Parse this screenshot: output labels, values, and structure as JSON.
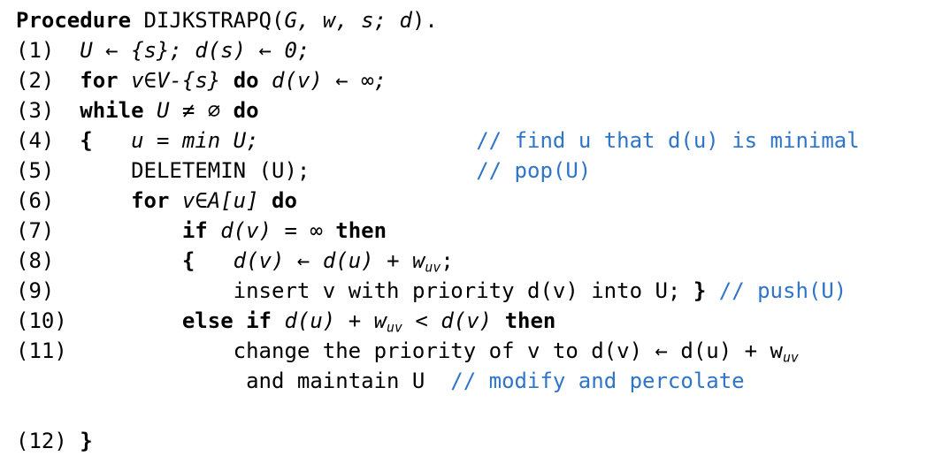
{
  "header": {
    "keyword": "Procedure",
    "name": "DIJKSTRAPQ",
    "args_open": "(",
    "args": "G, w, s; d",
    "args_close": ")."
  },
  "lines": [
    {
      "num": "(1)"
    },
    {
      "num": "(2)"
    },
    {
      "num": "(3)"
    },
    {
      "num": "(4)"
    },
    {
      "num": "(5)"
    },
    {
      "num": "(6)"
    },
    {
      "num": "(7)"
    },
    {
      "num": "(8)"
    },
    {
      "num": "(9)"
    },
    {
      "num": "(10)"
    },
    {
      "num": "(11)"
    },
    {
      "num": "(12)"
    }
  ],
  "comments": {
    "line4": "// find u that d(u) is minimal",
    "line5": "// pop(U)",
    "line9": "// push(U)",
    "line11": "// modify and percolate"
  },
  "text": {
    "line1": "U ← {s}; d(s) ← 0;",
    "for_kw": "for",
    "line2_mid": "v∈V-{s}",
    "do_kw": "do",
    "line2_tail": "d(v) ← ∞;",
    "while_kw": "while",
    "line3_mid": "U ≠ ∅",
    "brace_open": "{",
    "line4_code": "u = min U;",
    "line5_code": "DELETEMIN (U);",
    "line6_mid": "v∈A[u]",
    "if_kw": "if",
    "line7_mid": "d(v) = ∞",
    "then_kw": "then",
    "line8_a": "d(v) ← d(u) + w",
    "sub_uv": "uv",
    "line8_b": ";",
    "line9_code": "insert v with priority d(v) into U;",
    "brace_close": "}",
    "else_if_kw": "else if",
    "line10_a": "d(u) + w",
    "line10_b": " < d(v)",
    "line11_code": "change the priority of v to d(v) ← d(u) + w",
    "line11_cont": "and maintain U"
  }
}
